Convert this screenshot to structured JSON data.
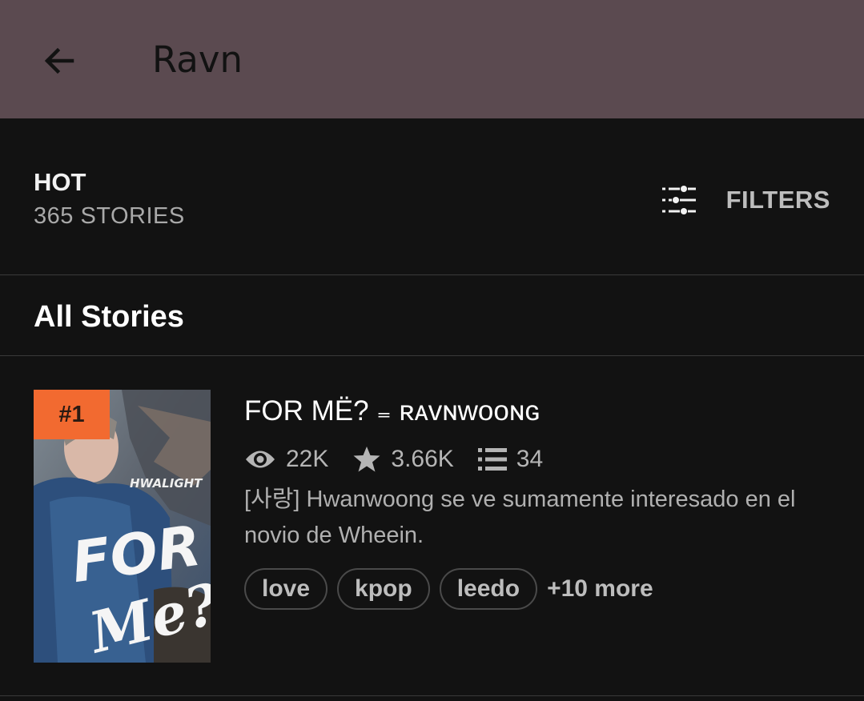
{
  "appbar": {
    "title": "Ravn"
  },
  "header": {
    "section_label": "HOT",
    "stories_count": "365 STORIES",
    "filters_label": "FILTERS"
  },
  "list": {
    "heading": "All Stories",
    "stories": [
      {
        "rank": "#1",
        "title": "FOR MË? ₌ ʀᴀᴠɴᴡᴏᴏɴɢ",
        "views": "22K",
        "votes": "3.66K",
        "parts": "34",
        "description": "[사랑] Hwanwoong se ve sumamente interesado en el novio de Wheein.",
        "tags": [
          "love",
          "kpop",
          "leedo"
        ],
        "more_tags": "+10 more",
        "cover_text": {
          "brand": "HWALIGHT",
          "line1": "FOR",
          "line2": "Me?"
        }
      }
    ]
  },
  "colors": {
    "appbar": "#5b4a50",
    "background": "#121212",
    "rank_badge": "#f26a30"
  }
}
